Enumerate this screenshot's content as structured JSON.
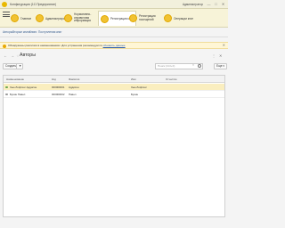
{
  "window": {
    "title": "Конфигурация  (1С:Предприятие)",
    "user": "Администратор",
    "controls": [
      "—",
      "□",
      "✕"
    ]
  },
  "sections": [
    {
      "label": "Главное",
      "icon": "home-icon"
    },
    {
      "label": "Администрирование",
      "icon": "settings-icon"
    },
    {
      "label": "Нормативно-справочная информация",
      "icon": "reference-icon"
    },
    {
      "label": "Регистрация книг",
      "icon": "books-icon",
      "active": true
    },
    {
      "label": "Регистрация посещений",
      "icon": "visits-icon"
    },
    {
      "label": "Операции книг",
      "icon": "operations-icon"
    }
  ],
  "subtabs": [
    "Авторы",
    "Вторые книги",
    "Книги",
    "Поступления книг"
  ],
  "notice": {
    "text": "Обнаружены различия в наименованиях. Для устранения рекомендуется",
    "link": "обновить данные"
  },
  "form": {
    "title": "Авторы",
    "back": "←",
    "forward": "→",
    "star": "☆",
    "more": "⋮",
    "close": "✕"
  },
  "toolbar": {
    "create_label": "Создать",
    "search_placeholder": "Поиск (Ctrl+F)",
    "more_label": "Еще ▾",
    "filter_label": "▼",
    "clear_label": "×"
  },
  "table": {
    "columns": [
      "Наименование",
      "Код",
      "Фамилия",
      "Имя",
      "Отчество"
    ],
    "rows": [
      {
        "name": "Хью Лофтинг Аддисон",
        "code": "000000001",
        "surname": "Аддисон",
        "first": "Хью Лофтинг",
        "patronymic": "",
        "selected": true
      },
      {
        "name": "Бунин Павел",
        "code": "000000002",
        "surname": "Павел",
        "first": "Бунин",
        "patronymic": "",
        "selected": false
      }
    ]
  },
  "colors": {
    "section_bar": "#f7f3d8",
    "section_icon": "#f1c232",
    "selected_row": "#faeebf",
    "notice_bg": "#fff6d5",
    "link": "#2a5db0"
  }
}
